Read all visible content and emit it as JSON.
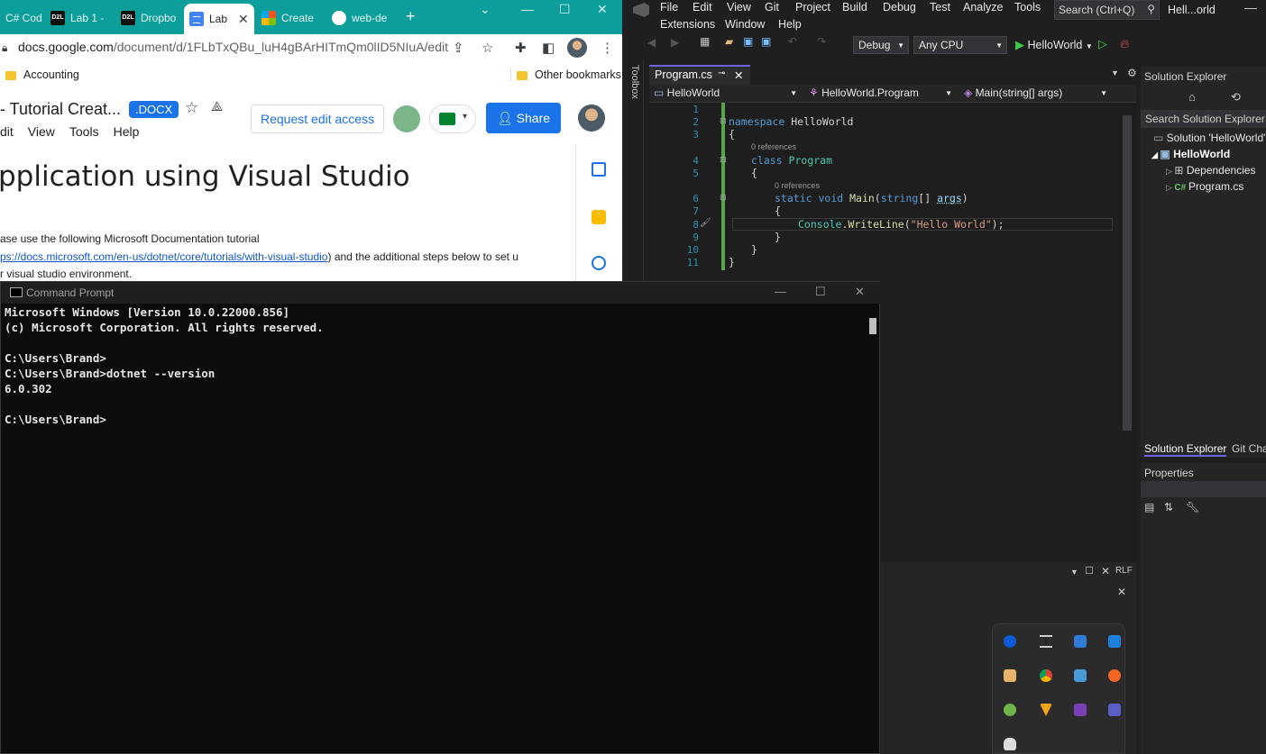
{
  "chrome": {
    "tabs": [
      {
        "label": "C# Cod",
        "icon": "csharp-text"
      },
      {
        "label": "Lab 1 -",
        "icon": "d2l-icon"
      },
      {
        "label": "Dropbo",
        "icon": "d2l-icon"
      },
      {
        "label": "Lab",
        "icon": "docs-icon"
      },
      {
        "label": "Create",
        "icon": "microsoft-icon"
      },
      {
        "label": "web-de",
        "icon": "github-icon"
      }
    ],
    "d2l_badge": "D2L",
    "url_host": "docs.google.com",
    "url_path": "/document/d/1FLbTxQBu_luH4gBArHITmQm0lID5NIuA/edit",
    "bookmarks": {
      "left": "Accounting",
      "right": "Other bookmarks"
    },
    "doc": {
      "title": "- Tutorial Creat...",
      "badge": ".DOCX",
      "menu": [
        "dit",
        "View",
        "Tools",
        "Help"
      ],
      "request_edit": "Request edit access",
      "share": "Share",
      "heading": "pplication using Visual Studio",
      "para1": "ase use the following Microsoft Documentation tutorial",
      "para2_link": "ps://docs.microsoft.com/en-us/dotnet/core/tutorials/with-visual-studio",
      "para2_rest": ") and the additional steps below to set u",
      "para3": "r visual studio environment."
    }
  },
  "vs": {
    "menu_row1": [
      "File",
      "Edit",
      "View",
      "Git",
      "Project",
      "Build",
      "Debug",
      "Test",
      "Analyze",
      "Tools"
    ],
    "menu_row2": [
      "Extensions",
      "Window",
      "Help"
    ],
    "search": "Search (Ctrl+Q)",
    "window_title": "Hell...orld",
    "config": "Debug",
    "platform": "Any CPU",
    "run_target": "HelloWorld",
    "toolbox": "Toolbox",
    "editor_tab": "Program.cs",
    "nav": {
      "project": "HelloWorld",
      "class": "HelloWorld.Program",
      "member": "Main(string[] args)"
    },
    "line_numbers": [
      "1",
      "2",
      "3",
      "4",
      "5",
      "6",
      "7",
      "8",
      "9",
      "10",
      "11"
    ],
    "code": {
      "ns_kw": "namespace",
      "ns_name": " HelloWorld",
      "brace_open": "{",
      "brace_close": "}",
      "refs": "0 references",
      "class_kw": "class",
      "class_name": " Program",
      "static_kw": "static",
      "void_kw": " void",
      "main_fn": " Main",
      "main_open": "(",
      "string_kw": "string",
      "main_arr": "[] ",
      "args": "args",
      "main_close": ")",
      "console": "Console",
      "dot": ".",
      "writeline": "WriteLine",
      "paren_open": "(",
      "str": "\"Hello World\"",
      "paren_close": ");"
    },
    "solution_explorer": {
      "title": "Solution Explorer",
      "search": "Search Solution Explorer (C",
      "items": [
        "Solution 'HelloWorld'",
        "HelloWorld",
        "Dependencies",
        "Program.cs"
      ],
      "tabs": [
        "Solution Explorer",
        "Git Cha"
      ]
    },
    "properties": "Properties",
    "status_crlf": "RLF",
    "colors": {
      "accent": "#7160e8",
      "run": "#3ec74a",
      "keyword": "#569cd6",
      "type": "#4ec9b0",
      "string": "#d69d85"
    }
  },
  "cmd": {
    "title": "Command Prompt",
    "lines": [
      "Microsoft Windows [Version 10.0.22000.856]",
      "(c) Microsoft Corporation. All rights reserved.",
      "",
      "C:\\Users\\Brand>",
      "C:\\Users\\Brand>dotnet --version",
      "6.0.302",
      "",
      "C:\\Users\\Brand>"
    ]
  }
}
